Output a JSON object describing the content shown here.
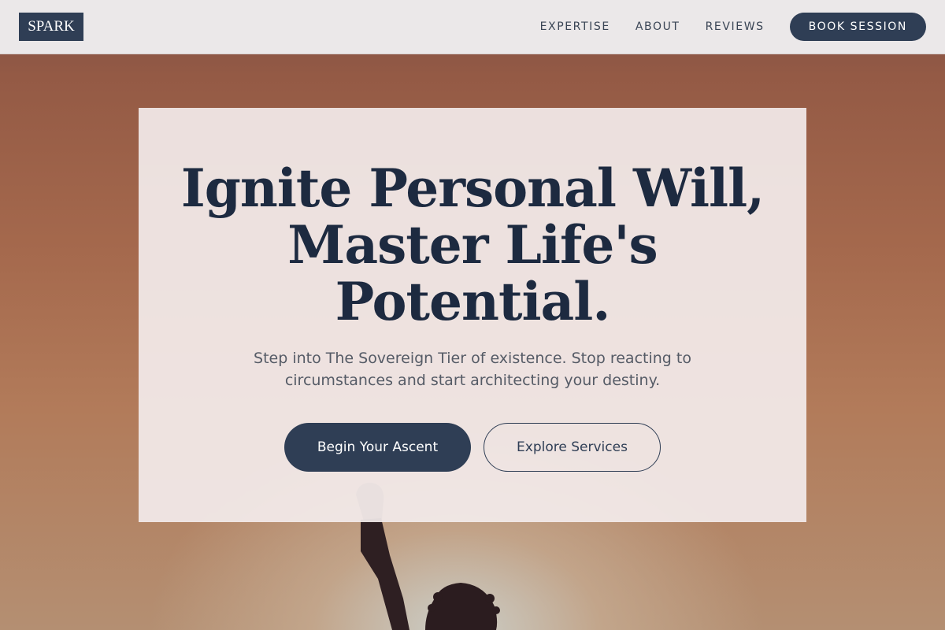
{
  "nav": {
    "logo": "SPARK",
    "links": [
      "EXPERTISE",
      "ABOUT",
      "REVIEWS"
    ],
    "cta": "BOOK SESSION"
  },
  "hero": {
    "headline_line1": "Ignite Personal Will,",
    "headline_line2": "Master Life's",
    "headline_line3": "Potential.",
    "subtext": "Step into The Sovereign Tier of existence. Stop reacting to circumstances and start architecting your destiny.",
    "primary_button": "Begin Your Ascent",
    "secondary_button": "Explore Services"
  },
  "colors": {
    "navy": "#2f3e55",
    "headline": "#1d2a40",
    "nav_bg": "#ebe8e9",
    "card_bg": "#f3eceb"
  }
}
